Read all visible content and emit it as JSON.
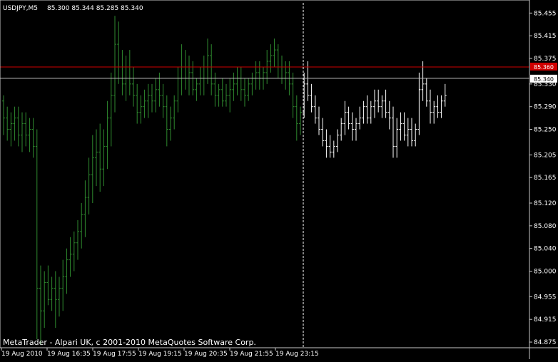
{
  "header": {
    "symbol_timeframe": "USDJPY,M5",
    "ohlc": "85.300 85.344 85.285 85.340"
  },
  "footer": {
    "copyright": "MetaTrader - Alpari UK, c 2001-2010 MetaQuotes Software Corp."
  },
  "colors": {
    "background": "#000000",
    "frame": "#c8c8c8",
    "bars_history": "#2f8a2f",
    "bars_recent": "#ffffff",
    "bid_line": "#c0c0c0",
    "ask_line": "#d00000",
    "ask_tag": "#d00000",
    "axis_text": "#ffffff",
    "separator": "#ffffff"
  },
  "chart_data": {
    "type": "bar",
    "style": "ohlc-bars",
    "y_axis": {
      "ylim": [
        84.865,
        85.473
      ],
      "ticks": [
        "85.455",
        "85.415",
        "85.375",
        "85.330",
        "85.290",
        "85.250",
        "85.205",
        "85.165",
        "85.120",
        "85.080",
        "85.040",
        "85.000",
        "84.955",
        "84.915",
        "84.875"
      ]
    },
    "x_axis": {
      "tick_labels": [
        "19 Aug 2010",
        "19 Aug 16:35",
        "19 Aug 17:55",
        "19 Aug 19:15",
        "19 Aug 20:35",
        "19 Aug 21:55",
        "19 Aug 23:15"
      ]
    },
    "horizontal_lines": [
      {
        "price": 85.34,
        "label": "85.340",
        "role": "bid",
        "color": "#c0c0c0"
      },
      {
        "price": 85.36,
        "label": "85.360",
        "role": "ask",
        "color": "#d00000"
      }
    ],
    "bars_green": [
      [
        85.3,
        85.31,
        85.24,
        85.27
      ],
      [
        85.27,
        85.29,
        85.23,
        85.25
      ],
      [
        85.25,
        85.28,
        85.22,
        85.26
      ],
      [
        85.26,
        85.29,
        85.23,
        85.27
      ],
      [
        85.27,
        85.29,
        85.22,
        85.24
      ],
      [
        85.24,
        85.28,
        85.21,
        85.26
      ],
      [
        85.26,
        85.28,
        85.22,
        85.24
      ],
      [
        85.24,
        85.27,
        85.21,
        85.25
      ],
      [
        85.25,
        85.27,
        85.2,
        85.22
      ],
      [
        85.22,
        85.25,
        84.88,
        84.97
      ],
      [
        84.97,
        85.01,
        84.87,
        84.93
      ],
      [
        84.93,
        85.0,
        84.9,
        84.98
      ],
      [
        84.98,
        85.01,
        84.94,
        84.95
      ],
      [
        84.95,
        84.99,
        84.93,
        84.97
      ],
      [
        84.97,
        85.0,
        84.9,
        84.95
      ],
      [
        84.95,
        84.99,
        84.92,
        84.97
      ],
      [
        84.97,
        85.02,
        84.93,
        84.99
      ],
      [
        84.99,
        85.04,
        84.96,
        85.02
      ],
      [
        85.02,
        85.06,
        84.99,
        85.03
      ],
      [
        85.03,
        85.07,
        85.0,
        85.05
      ],
      [
        85.05,
        85.09,
        85.02,
        85.07
      ],
      [
        85.07,
        85.12,
        85.04,
        85.1
      ],
      [
        85.1,
        85.16,
        85.06,
        85.13
      ],
      [
        85.13,
        85.2,
        85.1,
        85.17
      ],
      [
        85.17,
        85.24,
        85.12,
        85.2
      ],
      [
        85.2,
        85.25,
        85.15,
        85.21
      ],
      [
        85.21,
        85.26,
        85.14,
        85.18
      ],
      [
        85.18,
        85.25,
        85.15,
        85.22
      ],
      [
        85.22,
        85.3,
        85.18,
        85.27
      ],
      [
        85.27,
        85.35,
        85.22,
        85.31
      ],
      [
        85.31,
        85.45,
        85.28,
        85.4
      ],
      [
        85.4,
        85.44,
        85.33,
        85.36
      ],
      [
        85.36,
        85.39,
        85.31,
        85.33
      ],
      [
        85.33,
        85.38,
        85.3,
        85.36
      ],
      [
        85.36,
        85.39,
        85.31,
        85.33
      ],
      [
        85.33,
        85.36,
        85.29,
        85.31
      ],
      [
        85.31,
        85.33,
        85.26,
        85.28
      ],
      [
        85.28,
        85.31,
        85.26,
        85.29
      ],
      [
        85.29,
        85.32,
        85.27,
        85.3
      ],
      [
        85.3,
        85.33,
        85.27,
        85.31
      ],
      [
        85.31,
        85.33,
        85.28,
        85.3
      ],
      [
        85.3,
        85.34,
        85.28,
        85.32
      ],
      [
        85.32,
        85.35,
        85.29,
        85.31
      ],
      [
        85.31,
        85.33,
        85.27,
        85.29
      ],
      [
        85.29,
        85.31,
        85.22,
        85.25
      ],
      [
        85.25,
        85.29,
        85.23,
        85.27
      ],
      [
        85.27,
        85.31,
        85.25,
        85.3
      ],
      [
        85.3,
        85.36,
        85.28,
        85.34
      ],
      [
        85.34,
        85.4,
        85.31,
        85.36
      ],
      [
        85.36,
        85.39,
        85.32,
        85.34
      ],
      [
        85.34,
        85.38,
        85.31,
        85.35
      ],
      [
        85.35,
        85.37,
        85.31,
        85.32
      ],
      [
        85.32,
        85.34,
        85.3,
        85.33
      ],
      [
        85.33,
        85.36,
        85.31,
        85.34
      ],
      [
        85.34,
        85.38,
        85.31,
        85.36
      ],
      [
        85.36,
        85.41,
        85.33,
        85.38
      ],
      [
        85.38,
        85.4,
        85.31,
        85.33
      ],
      [
        85.33,
        85.35,
        85.29,
        85.31
      ],
      [
        85.31,
        85.33,
        85.29,
        85.32
      ],
      [
        85.32,
        85.34,
        85.29,
        85.3
      ],
      [
        85.3,
        85.33,
        85.29,
        85.31
      ],
      [
        85.31,
        85.34,
        85.28,
        85.32
      ],
      [
        85.32,
        85.35,
        85.3,
        85.33
      ],
      [
        85.33,
        85.36,
        85.31,
        85.34
      ],
      [
        85.34,
        85.36,
        85.3,
        85.32
      ],
      [
        85.32,
        85.34,
        85.29,
        85.31
      ],
      [
        85.31,
        85.34,
        85.3,
        85.33
      ],
      [
        85.33,
        85.35,
        85.31,
        85.34
      ],
      [
        85.34,
        85.37,
        85.32,
        85.35
      ],
      [
        85.35,
        85.37,
        85.32,
        85.34
      ],
      [
        85.34,
        85.36,
        85.32,
        85.35
      ],
      [
        85.35,
        85.39,
        85.33,
        85.37
      ],
      [
        85.37,
        85.4,
        85.35,
        85.38
      ],
      [
        85.38,
        85.41,
        85.36,
        85.39
      ],
      [
        85.39,
        85.4,
        85.34,
        85.36
      ],
      [
        85.36,
        85.38,
        85.33,
        85.34
      ],
      [
        85.34,
        85.37,
        85.32,
        85.35
      ],
      [
        85.35,
        85.37,
        85.31,
        85.33
      ],
      [
        85.33,
        85.35,
        85.27,
        85.29
      ],
      [
        85.29,
        85.31,
        85.23,
        85.26
      ],
      [
        85.26,
        85.29,
        85.24,
        85.28
      ]
    ],
    "bars_white": [
      [
        85.28,
        85.35,
        85.27,
        85.33
      ],
      [
        85.33,
        85.37,
        85.3,
        85.31
      ],
      [
        85.31,
        85.33,
        85.28,
        85.29
      ],
      [
        85.29,
        85.31,
        85.26,
        85.27
      ],
      [
        85.27,
        85.29,
        85.24,
        85.25
      ],
      [
        85.25,
        85.27,
        85.22,
        85.23
      ],
      [
        85.23,
        85.25,
        85.2,
        85.22
      ],
      [
        85.22,
        85.24,
        85.2,
        85.21
      ],
      [
        85.21,
        85.23,
        85.2,
        85.22
      ],
      [
        85.22,
        85.25,
        85.21,
        85.24
      ],
      [
        85.24,
        85.27,
        85.23,
        85.26
      ],
      [
        85.26,
        85.3,
        85.24,
        85.28
      ],
      [
        85.28,
        85.29,
        85.25,
        85.26
      ],
      [
        85.26,
        85.28,
        85.23,
        85.25
      ],
      [
        85.25,
        85.27,
        85.23,
        85.26
      ],
      [
        85.26,
        85.29,
        85.25,
        85.27
      ],
      [
        85.27,
        85.3,
        85.26,
        85.29
      ],
      [
        85.29,
        85.31,
        85.26,
        85.27
      ],
      [
        85.27,
        85.3,
        85.26,
        85.29
      ],
      [
        85.29,
        85.32,
        85.27,
        85.3
      ],
      [
        85.3,
        85.32,
        85.28,
        85.29
      ],
      [
        85.29,
        85.31,
        85.27,
        85.3
      ],
      [
        85.3,
        85.32,
        85.27,
        85.28
      ],
      [
        85.28,
        85.3,
        85.25,
        85.27
      ],
      [
        85.27,
        85.29,
        85.2,
        85.22
      ],
      [
        85.22,
        85.27,
        85.2,
        85.25
      ],
      [
        85.25,
        85.28,
        85.23,
        85.26
      ],
      [
        85.26,
        85.28,
        85.23,
        85.24
      ],
      [
        85.24,
        85.27,
        85.22,
        85.25
      ],
      [
        85.25,
        85.27,
        85.22,
        85.23
      ],
      [
        85.23,
        85.26,
        85.22,
        85.25
      ],
      [
        85.25,
        85.35,
        85.24,
        85.32
      ],
      [
        85.32,
        85.37,
        85.3,
        85.33
      ],
      [
        85.33,
        85.34,
        85.29,
        85.3
      ],
      [
        85.3,
        85.32,
        85.26,
        85.28
      ],
      [
        85.28,
        85.3,
        85.26,
        85.29
      ],
      [
        85.29,
        85.31,
        85.27,
        85.28
      ],
      [
        85.28,
        85.31,
        85.27,
        85.3
      ],
      [
        85.3,
        85.33,
        85.29,
        85.31
      ]
    ]
  }
}
